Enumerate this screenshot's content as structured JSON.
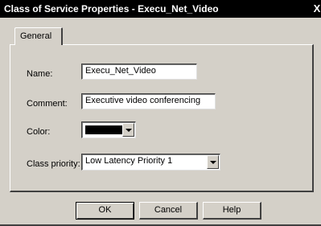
{
  "window": {
    "title": "Class of Service Properties - Execu_Net_Video",
    "close_glyph": "X"
  },
  "tabs": [
    {
      "label": "General",
      "selected": true
    }
  ],
  "form": {
    "name": {
      "label": "Name:",
      "value": "Execu_Net_Video"
    },
    "comment": {
      "label": "Comment:",
      "value": "Executive video conferencing"
    },
    "color": {
      "label": "Color:",
      "value": "#000000"
    },
    "class_priority": {
      "label": "Class priority:",
      "value": "Low Latency Priority 1"
    }
  },
  "buttons": {
    "ok": "OK",
    "cancel": "Cancel",
    "help": "Help"
  }
}
